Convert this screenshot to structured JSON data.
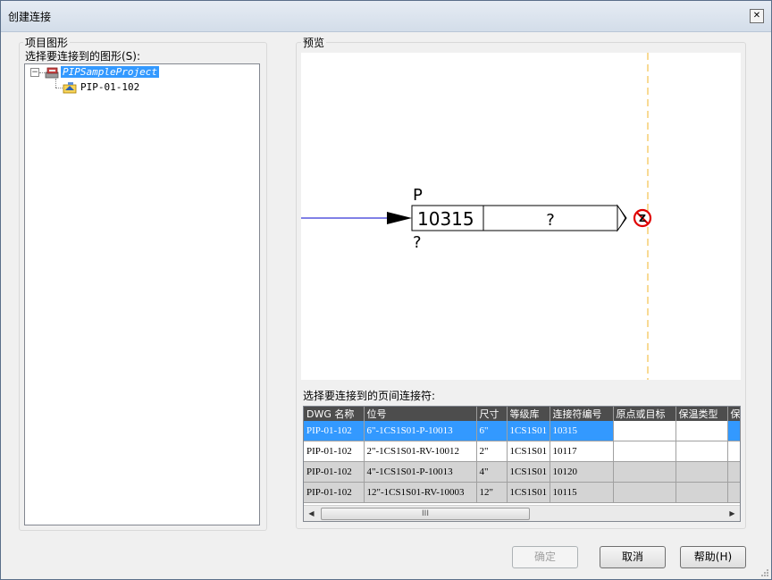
{
  "window": {
    "title": "创建连接",
    "close_glyph": "✕"
  },
  "left_panel": {
    "group_label": "项目图形",
    "select_label": "选择要连接到的图形(S):",
    "tree": {
      "project": "PIPSampleProject",
      "drawing": "PIP-01-102",
      "expander_glyph": "−"
    }
  },
  "preview": {
    "group_label": "预览",
    "connector": {
      "top_label": "P",
      "number": "10315",
      "destination": "?",
      "bottom_label": "?"
    }
  },
  "connectors": {
    "label": "选择要连接到的页间连接符:",
    "columns": [
      "DWG 名称",
      "位号",
      "尺寸",
      "等级库",
      "连接符编号",
      "原点或目标",
      "保温类型",
      "保"
    ],
    "rows": [
      {
        "dwg": "PIP-01-102",
        "tag": "6\"-1CS1S01-P-10013",
        "size": "6\"",
        "spec": "1CS1S01",
        "number": "10315",
        "selected": true
      },
      {
        "dwg": "PIP-01-102",
        "tag": "2\"-1CS1S01-RV-10012",
        "size": "2\"",
        "spec": "1CS1S01",
        "number": "10117",
        "selected": false
      },
      {
        "dwg": "PIP-01-102",
        "tag": "4\"-1CS1S01-P-10013",
        "size": "4\"",
        "spec": "1CS1S01",
        "number": "10120",
        "selected": false
      },
      {
        "dwg": "PIP-01-102",
        "tag": "12\"-1CS1S01-RV-10003",
        "size": "12\"",
        "spec": "1CS1S01",
        "number": "10115",
        "selected": false
      }
    ],
    "scroll": {
      "left_glyph": "◀",
      "right_glyph": "▶",
      "thumb_glyph": "III"
    }
  },
  "buttons": {
    "ok": "确定",
    "cancel": "取消",
    "help": "帮助(H)"
  },
  "colors": {
    "selection": "#3399ff",
    "header": "#4d4d4d",
    "flow_line": "#0000cc",
    "boundary": "#f2c14e",
    "error": "#e00000"
  }
}
